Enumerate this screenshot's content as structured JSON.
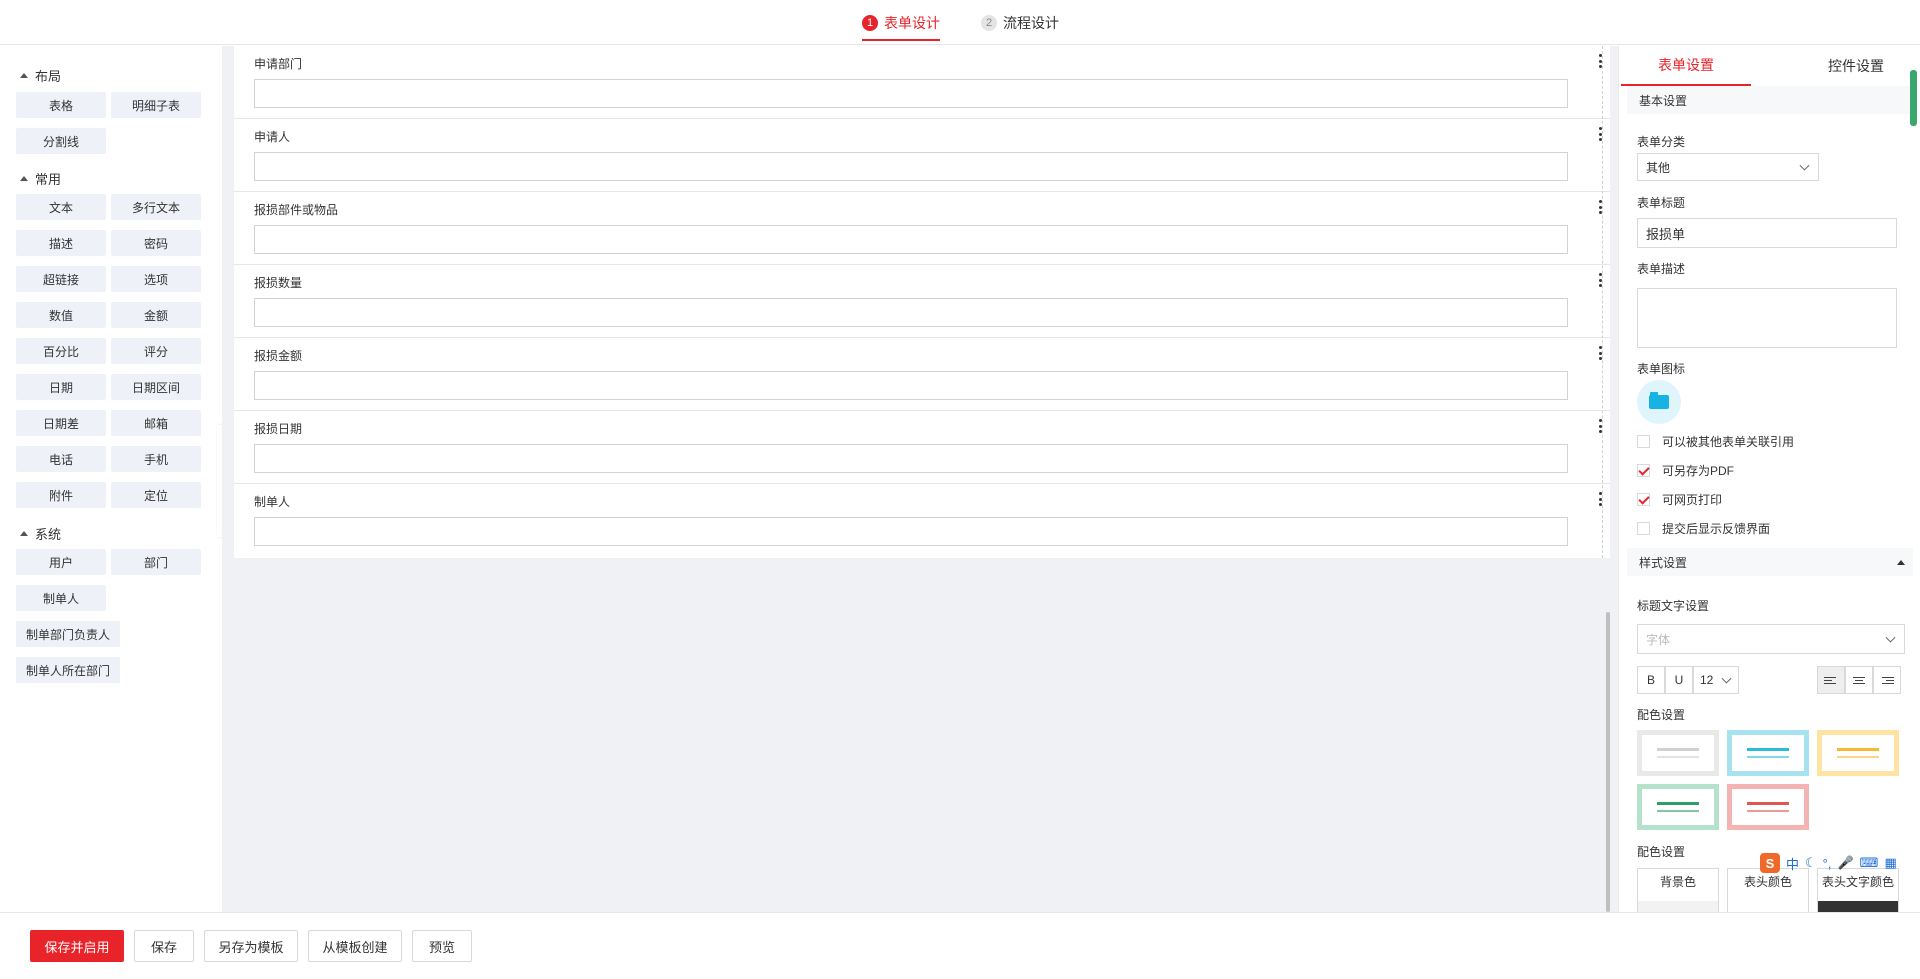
{
  "steps": [
    {
      "num": "1",
      "label": "表单设计"
    },
    {
      "num": "2",
      "label": "流程设计"
    }
  ],
  "palette": {
    "groups": [
      {
        "title": "布局",
        "items": [
          "表格",
          "明细子表",
          "分割线"
        ]
      },
      {
        "title": "常用",
        "items": [
          "文本",
          "多行文本",
          "描述",
          "密码",
          "超链接",
          "选项",
          "数值",
          "金额",
          "百分比",
          "评分",
          "日期",
          "日期区间",
          "日期差",
          "邮箱",
          "电话",
          "手机",
          "附件",
          "定位"
        ]
      },
      {
        "title": "系统",
        "items": [
          "用户",
          "部门",
          "制单人",
          "制单部门负责人",
          "制单人所在部门"
        ]
      }
    ]
  },
  "fields": [
    "申请部门",
    "申请人",
    "报损部件或物品",
    "报损数量",
    "报损金额",
    "报损日期",
    "制单人"
  ],
  "panel": {
    "tabs": [
      "表单设置",
      "控件设置"
    ],
    "basic_section": "基本设置",
    "category_label": "表单分类",
    "category_value": "其他",
    "title_label": "表单标题",
    "title_value": "报损单",
    "desc_label": "表单描述",
    "icon_label": "表单图标",
    "checks": [
      {
        "label": "可以被其他表单关联引用",
        "checked": false
      },
      {
        "label": "可另存为PDF",
        "checked": true
      },
      {
        "label": "可网页打印",
        "checked": true
      },
      {
        "label": "提交后显示反馈界面",
        "checked": false
      }
    ],
    "style_section": "样式设置",
    "title_text_label": "标题文字设置",
    "font_placeholder": "字体",
    "bold": "B",
    "underline": "U",
    "font_size": "12",
    "color_scheme_label": "配色设置",
    "swatches": [
      {
        "bg": "#e9e9e9",
        "line": "#d0d0d0"
      },
      {
        "bg": "#a6e3ef",
        "line": "#2bbcd9"
      },
      {
        "bg": "#ffe3a3",
        "line": "#f5b932"
      },
      {
        "bg": "#b5e2cb",
        "line": "#2f9e67"
      },
      {
        "bg": "#f4b4b4",
        "line": "#e05555"
      }
    ],
    "color_settings_label": "配色设置",
    "color_boxes": [
      {
        "label": "背景色",
        "fill": "#f2f2f2"
      },
      {
        "label": "表头颜色",
        "fill": "#ffffff"
      },
      {
        "label": "表头文字颜色",
        "fill": "#333333"
      }
    ]
  },
  "ime": {
    "logo": "S",
    "mode": "中",
    "items": [
      "☾",
      "°,",
      "🎤",
      "⌨",
      "▦"
    ]
  },
  "bottom": {
    "save_enable": "保存并启用",
    "save": "保存",
    "save_template": "另存为模板",
    "from_template": "从模板创建",
    "preview": "预览"
  },
  "colors": {
    "accent": "#e8232a",
    "canvas_bg": "#f0f1f5",
    "palette_btn": "#eef1f7"
  }
}
